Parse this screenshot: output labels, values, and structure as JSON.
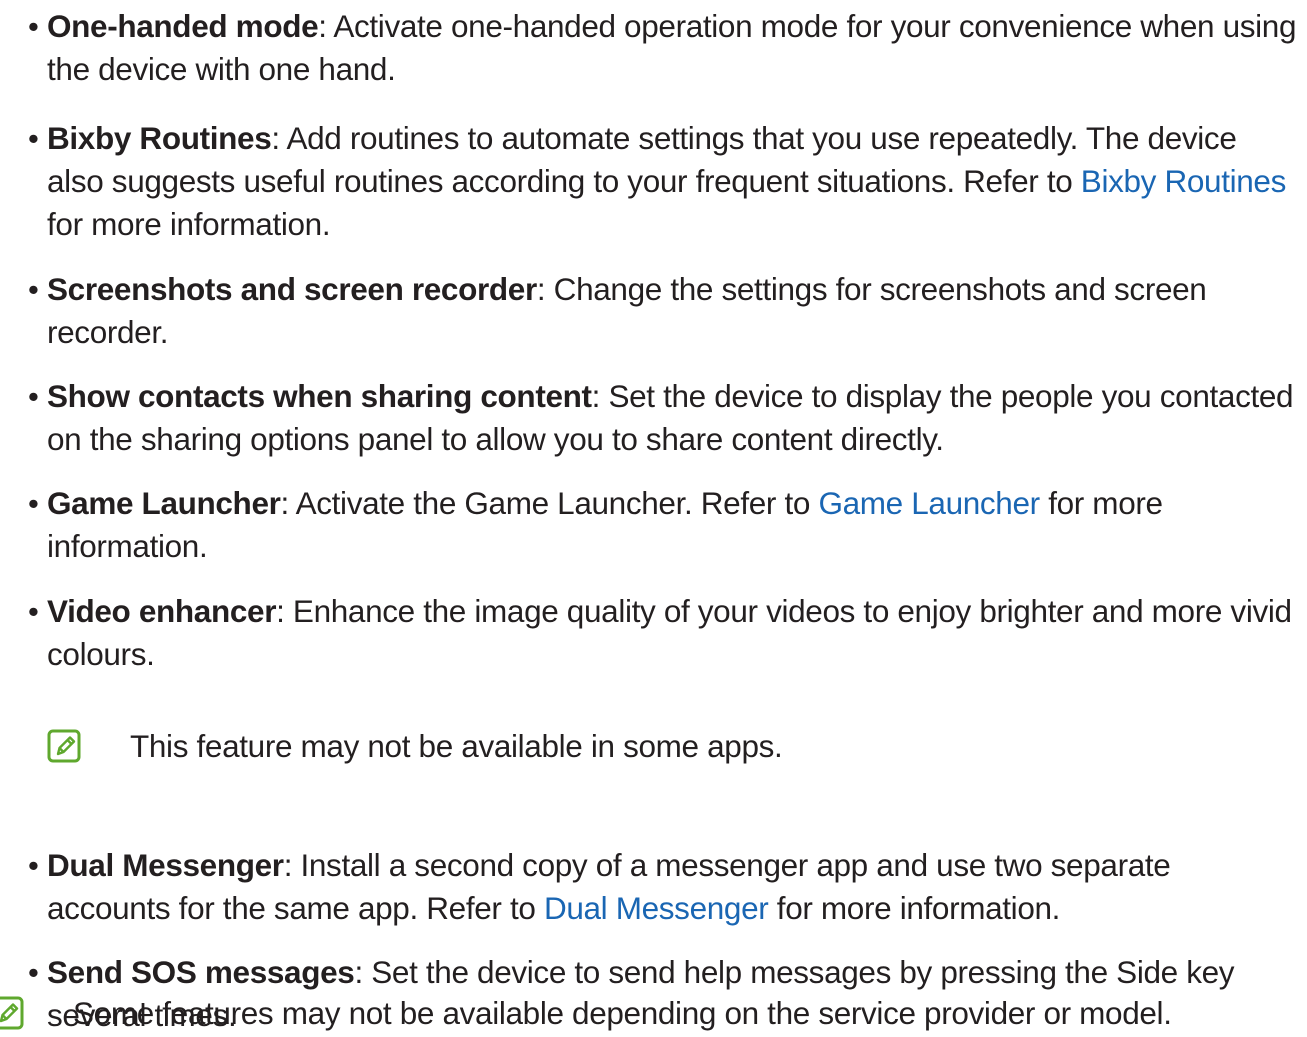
{
  "items": [
    {
      "title": "One-handed mode",
      "text": ": Activate one-handed operation mode for your convenience when using the device with one hand."
    },
    {
      "title": "Bixby Routines",
      "text": ": Add routines to automate settings that you use repeatedly. The device also suggests useful routines according to your frequent situations. Refer to ",
      "link": "Bixby Routines",
      "after": " for more information."
    },
    {
      "title": "Screenshots and screen recorder",
      "text": ": Change the settings for screenshots and screen recorder."
    },
    {
      "title": "Show contacts when sharing content",
      "text": ": Set the device to display the people you contacted on the sharing options panel to allow you to share content directly."
    },
    {
      "title": "Game Launcher",
      "text": ": Activate the Game Launcher. Refer to ",
      "link": "Game Launcher",
      "after": " for more information."
    },
    {
      "title": "Video enhancer",
      "text": ": Enhance the image quality of your videos to enjoy brighter and more vivid colours."
    },
    {
      "title": "Dual Messenger",
      "text": ": Install a second copy of a messenger app and use two separate accounts for the same app. Refer to ",
      "link": "Dual Messenger",
      "after": " for more information."
    },
    {
      "title": "Send SOS messages",
      "text": ": Set the device to send help messages by pressing the Side key several times."
    }
  ],
  "notes": {
    "video_enhancer_note": "This feature may not be available in some apps.",
    "bottom_note": "Some features may not be available depending on the service provider or model."
  },
  "colors": {
    "text": "#231f20",
    "link": "#1a66b3",
    "note_icon": "#5fa82e"
  },
  "icons": {
    "note": "note-pencil-icon"
  }
}
